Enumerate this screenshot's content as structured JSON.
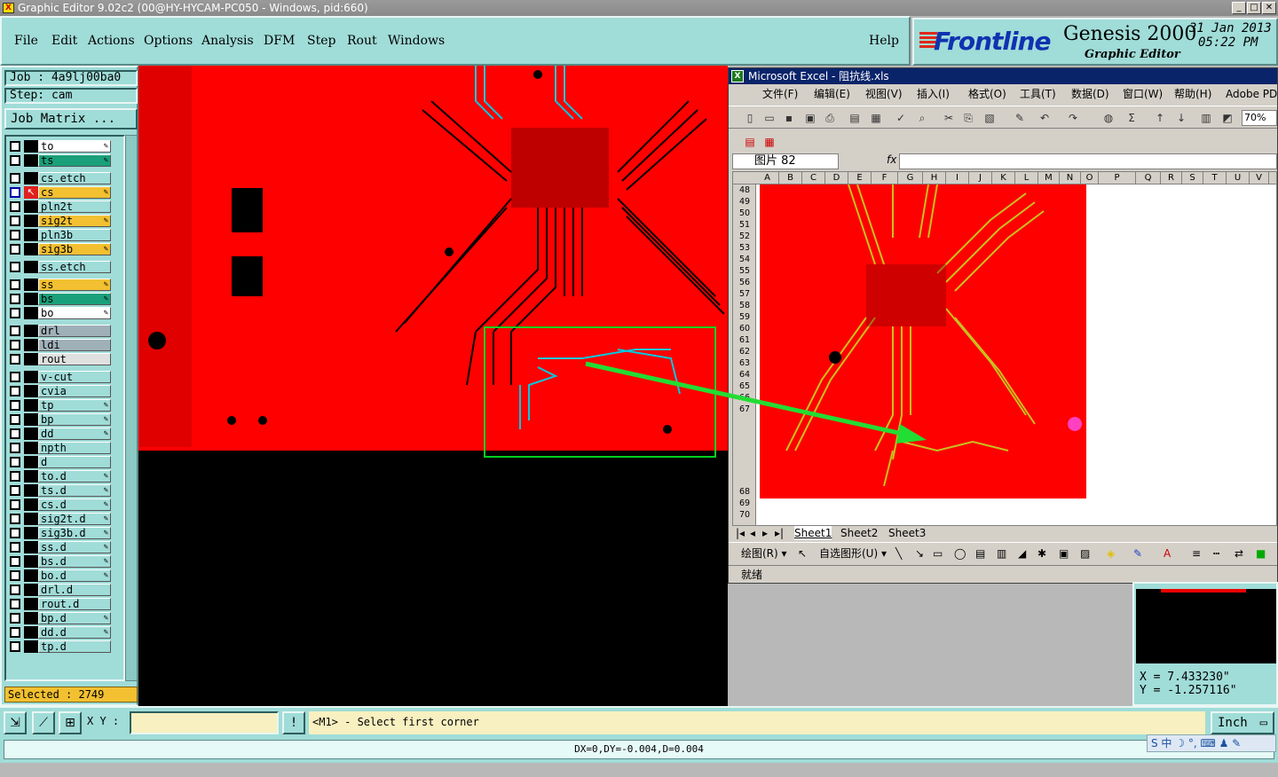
{
  "window": {
    "title": "Graphic Editor 9.02c2 (00@HY-HYCAM-PC050 - Windows, pid:660)",
    "min": "_",
    "max": "□",
    "close": "✕"
  },
  "menu": {
    "items": [
      "File",
      "Edit",
      "Actions",
      "Options",
      "Analysis",
      "DFM",
      "Step",
      "Rout",
      "Windows"
    ],
    "help": "Help"
  },
  "brand": {
    "logo": "Frontline",
    "product": "Genesis 2000",
    "subtitle": "Graphic Editor",
    "date": "31 Jan 2013",
    "time": "05:22 PM"
  },
  "job": {
    "job_label": "Job : 4a9lj00ba0",
    "step_label": "Step: cam",
    "matrix_button": "Job Matrix ..."
  },
  "layers": [
    {
      "name": "to",
      "color": "#ffffff",
      "pen": true
    },
    {
      "name": "ts",
      "color": "#1aa07a",
      "pen": true
    },
    {
      "name": "cs.etch",
      "color": "#a0dcd8",
      "pen": false
    },
    {
      "name": "cs",
      "color": "#f2c030",
      "pen": true,
      "active": true
    },
    {
      "name": "pln2t",
      "color": "#a0dcd8",
      "pen": false
    },
    {
      "name": "sig2t",
      "color": "#f2c030",
      "pen": true
    },
    {
      "name": "pln3b",
      "color": "#a0dcd8",
      "pen": false
    },
    {
      "name": "sig3b",
      "color": "#f2c030",
      "pen": true
    },
    {
      "name": "ss.etch",
      "color": "#a0dcd8",
      "pen": false
    },
    {
      "name": "ss",
      "color": "#f2c030",
      "pen": true
    },
    {
      "name": "bs",
      "color": "#1aa07a",
      "pen": true
    },
    {
      "name": "bo",
      "color": "#ffffff",
      "pen": true
    },
    {
      "name": "drl",
      "color": "#a0b0b8",
      "pen": false
    },
    {
      "name": "ldi",
      "color": "#a0b0b8",
      "pen": false
    },
    {
      "name": "rout",
      "color": "#e0e0e0",
      "pen": false
    },
    {
      "name": "v-cut",
      "color": "#a0dcd8",
      "pen": false
    },
    {
      "name": "cvia",
      "color": "#a0dcd8",
      "pen": false
    },
    {
      "name": "tp",
      "color": "#a0dcd8",
      "pen": true
    },
    {
      "name": "bp",
      "color": "#a0dcd8",
      "pen": true
    },
    {
      "name": "dd",
      "color": "#a0dcd8",
      "pen": true
    },
    {
      "name": "npth",
      "color": "#a0dcd8",
      "pen": false
    },
    {
      "name": "d",
      "color": "#a0dcd8",
      "pen": false
    },
    {
      "name": "to.d",
      "color": "#a0dcd8",
      "pen": true
    },
    {
      "name": "ts.d",
      "color": "#a0dcd8",
      "pen": true
    },
    {
      "name": "cs.d",
      "color": "#a0dcd8",
      "pen": true
    },
    {
      "name": "sig2t.d",
      "color": "#a0dcd8",
      "pen": true
    },
    {
      "name": "sig3b.d",
      "color": "#a0dcd8",
      "pen": true
    },
    {
      "name": "ss.d",
      "color": "#a0dcd8",
      "pen": true
    },
    {
      "name": "bs.d",
      "color": "#a0dcd8",
      "pen": true
    },
    {
      "name": "bo.d",
      "color": "#a0dcd8",
      "pen": true
    },
    {
      "name": "drl.d",
      "color": "#a0dcd8",
      "pen": false
    },
    {
      "name": "rout.d",
      "color": "#a0dcd8",
      "pen": false
    },
    {
      "name": "bp.d",
      "color": "#a0dcd8",
      "pen": true
    },
    {
      "name": "dd.d",
      "color": "#a0dcd8",
      "pen": true
    },
    {
      "name": "tp.d",
      "color": "#a0dcd8",
      "pen": false
    }
  ],
  "selected": "Selected : 2749",
  "coords": {
    "x": "X  =  7.433230\"",
    "y": "Y  = -1.257116\""
  },
  "bottom": {
    "xy_label": "X Y :",
    "xy_value": "",
    "prompt": "<M1> - Select first corner",
    "units": "Inch",
    "status": "DX=0,DY=-0.004,D=0.004"
  },
  "ime": "S 中 ☽ °, ⌨ ♟ ✎",
  "excel": {
    "title": "Microsoft Excel - 阻抗线.xls",
    "menu": [
      "文件(F)",
      "编辑(E)",
      "视图(V)",
      "插入(I)",
      "格式(O)",
      "工具(T)",
      "数据(D)",
      "窗口(W)",
      "帮助(H)",
      "Adobe PDF("
    ],
    "zoom": "70%",
    "name_box": "图片 82",
    "fx": "fx",
    "columns": [
      "A",
      "B",
      "C",
      "D",
      "E",
      "F",
      "G",
      "H",
      "I",
      "J",
      "K",
      "L",
      "M",
      "N",
      "O",
      "P",
      "Q",
      "R",
      "S",
      "T",
      "U",
      "V"
    ],
    "rows": [
      "48",
      "49",
      "50",
      "51",
      "52",
      "53",
      "54",
      "55",
      "56",
      "57",
      "58",
      "59",
      "60",
      "61",
      "62",
      "63",
      "64",
      "65",
      "66",
      "67",
      "68",
      "69",
      "70"
    ],
    "sheets": [
      "Sheet1",
      "Sheet2",
      "Sheet3"
    ],
    "draw_label": "绘图(R) ▾",
    "autoshape_label": "自选图形(U) ▾",
    "status": "就绪"
  }
}
